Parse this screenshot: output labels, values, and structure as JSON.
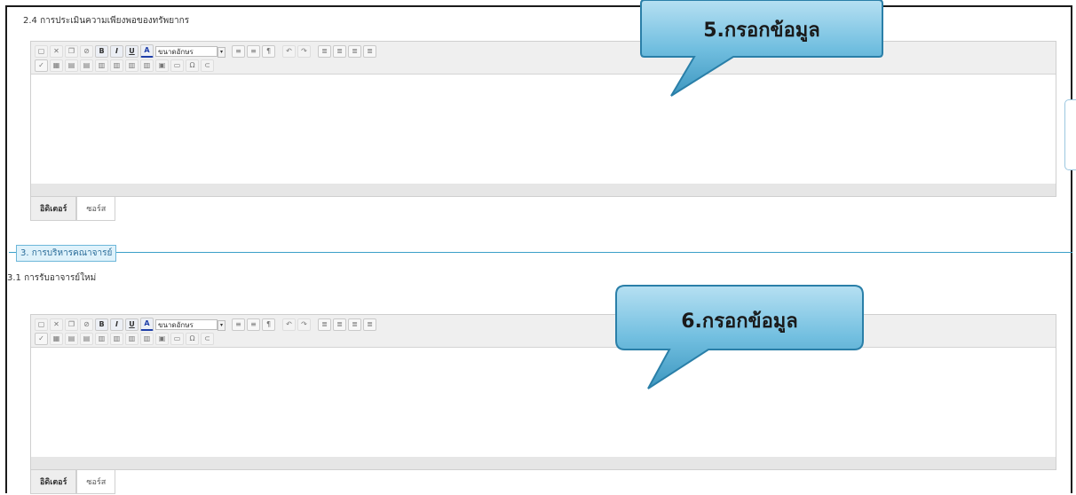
{
  "form": {
    "field_2_4_label": "2.4 การประเมินความเพียงพอของทรัพยากร",
    "section_3_legend": "3. การบริหารคณาจารย์",
    "field_3_1_label": "3.1 การรับอาจารย์ใหม่"
  },
  "editor": {
    "font_size_placeholder": "ขนาดอักษร",
    "tab_editor": "อิดิเตอร์",
    "tab_source": "ซอร์ส",
    "toolbar_row1": [
      "new-page",
      "cut",
      "copy",
      "paste",
      "bold",
      "italic",
      "underline",
      "font-color",
      "font-size",
      "bullet-list",
      "number-list",
      "paragraph",
      "undo",
      "redo",
      "align-left",
      "align-center",
      "align-right",
      "justify"
    ],
    "toolbar_row2": [
      "spellcheck",
      "table",
      "insert-row",
      "delete-row",
      "merge-cells",
      "split-cells",
      "insert-column",
      "delete-column",
      "image",
      "hr",
      "special-char",
      "link"
    ]
  },
  "callouts": {
    "step5": "5.กรอกข้อมูล",
    "step6": "6.กรอกข้อมูล"
  },
  "colors": {
    "callout_fill_top": "#9ed3ec",
    "callout_fill_bottom": "#3e9cc5",
    "section_line": "#3aa0c8",
    "frame": "#1a1a1a"
  }
}
